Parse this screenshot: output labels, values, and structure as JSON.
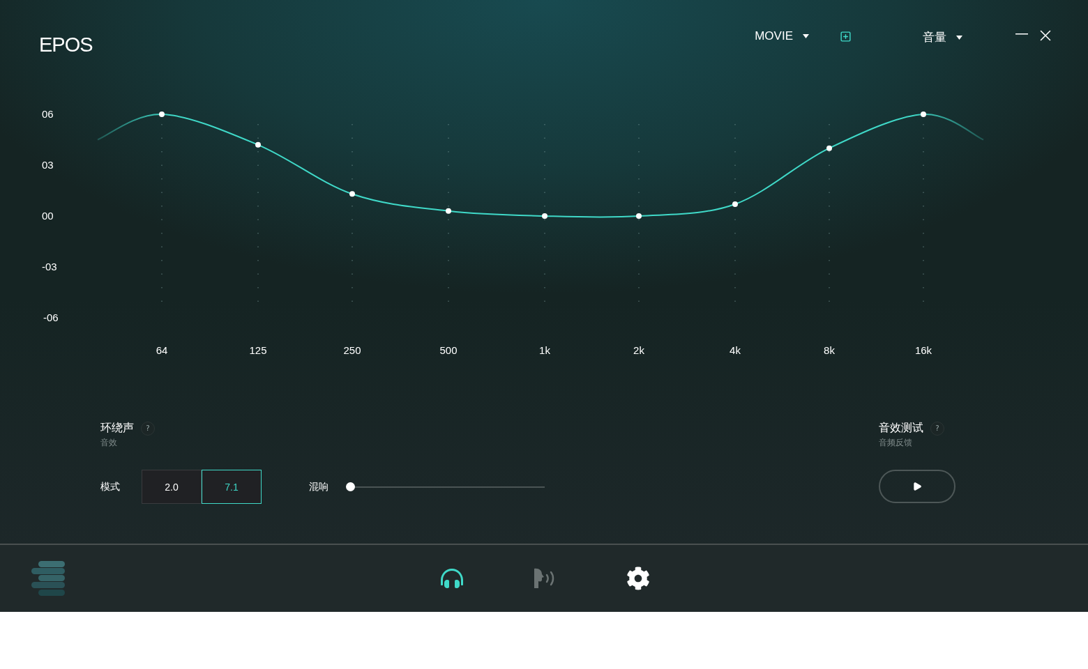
{
  "header": {
    "logo": "EPOS",
    "preset": "MOVIE",
    "volume_menu": "音量"
  },
  "equalizer": {
    "chart_data": {
      "type": "line",
      "categories": [
        "64",
        "125",
        "250",
        "500",
        "1k",
        "2k",
        "4k",
        "8k",
        "16k"
      ],
      "series": [
        {
          "color": "#3fd9c8",
          "marker": true,
          "values": [
            6,
            4.2,
            1.3,
            0.3,
            0,
            0,
            0.7,
            4,
            6
          ]
        }
      ],
      "grid": true,
      "ylim": [
        -6,
        6
      ],
      "yticks": [
        {
          "value": 6,
          "label": "06"
        },
        {
          "value": 3,
          "label": "03"
        },
        {
          "value": 0,
          "label": "00"
        },
        {
          "value": -3,
          "label": "-03"
        },
        {
          "value": -6,
          "label": "-06"
        }
      ]
    }
  },
  "surround": {
    "title": "环绕声",
    "subtitle": "音效",
    "help": "?",
    "mode_label": "模式",
    "modes": [
      {
        "label": "2.0",
        "selected": false
      },
      {
        "label": "7.1",
        "selected": true
      }
    ],
    "reverb": {
      "label": "混响",
      "level": 0
    }
  },
  "sound_test": {
    "title": "音效测试",
    "subtitle": "音频反馈",
    "help": "?"
  },
  "nav": [
    {
      "kind": "headphones",
      "selected": true,
      "disabled": false
    },
    {
      "kind": "voice",
      "selected": false,
      "disabled": true
    },
    {
      "kind": "settings",
      "selected": false,
      "disabled": false
    }
  ]
}
